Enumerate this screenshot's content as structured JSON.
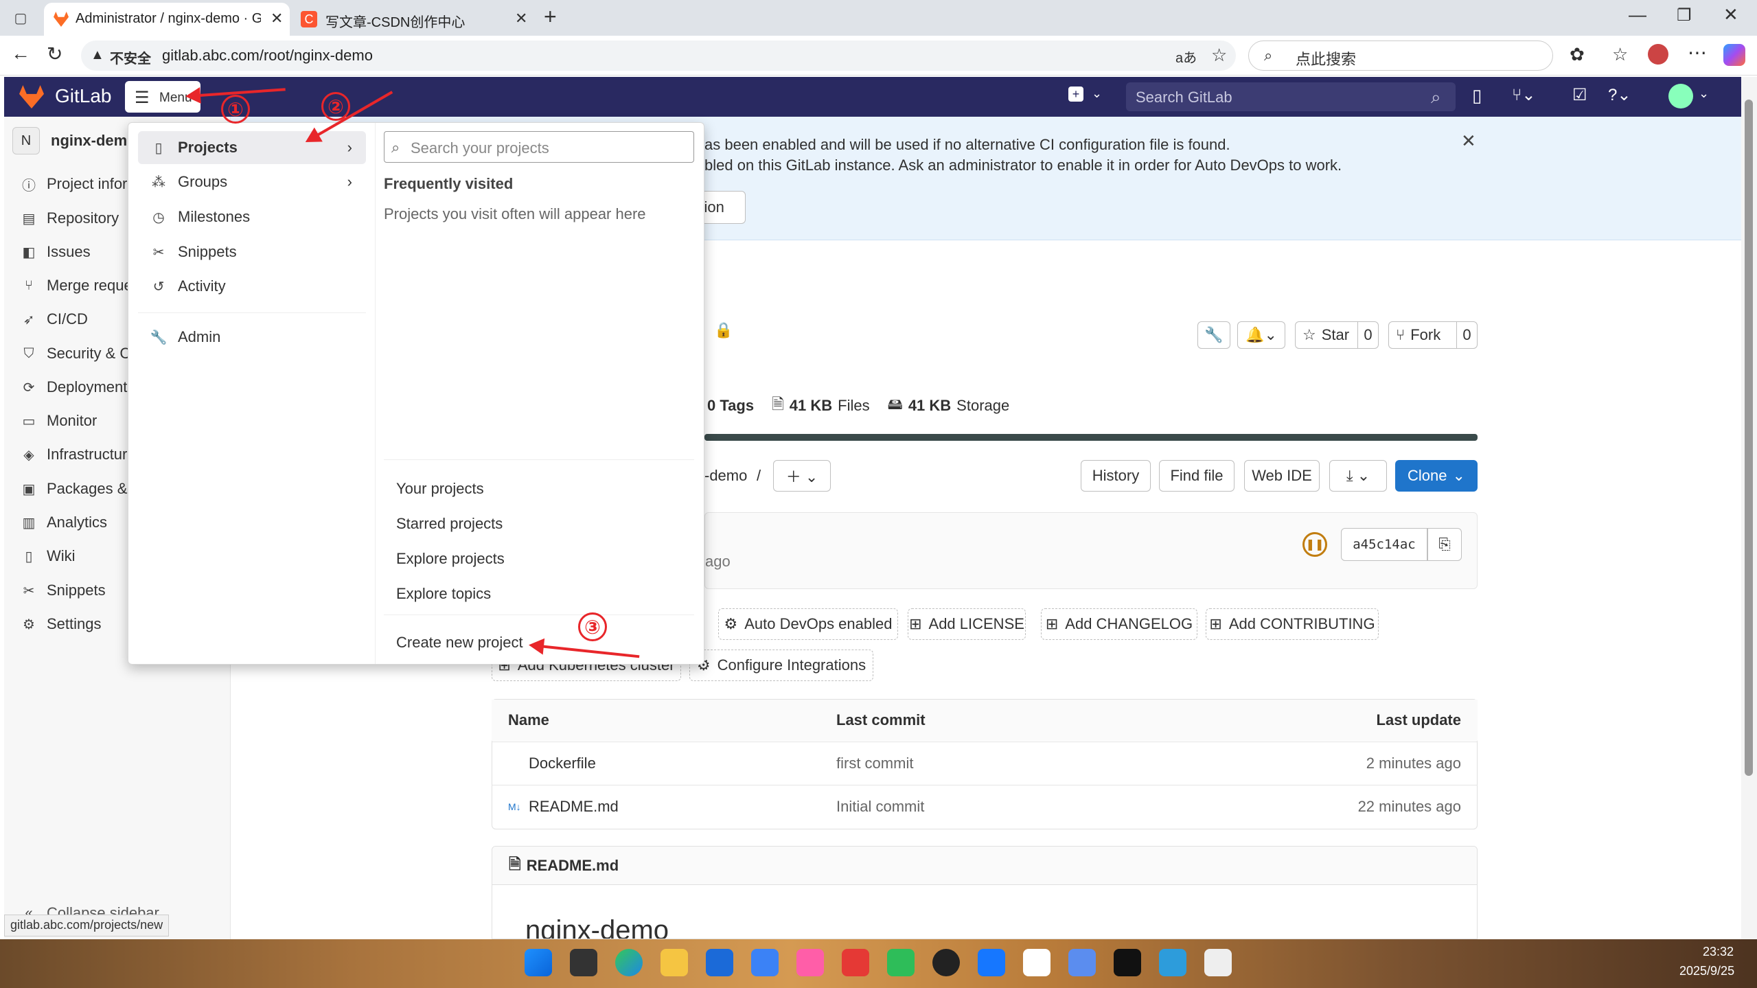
{
  "browser": {
    "tab1_title": "Administrator / nginx-demo · GitL",
    "tab2_title": "写文章-CSDN创作中心",
    "security_label": "不安全",
    "url": "gitlab.abc.com/root/nginx-demo",
    "search_placeholder": "点此搜索"
  },
  "gitlab_nav": {
    "brand": "GitLab",
    "menu_label": "Menu",
    "search_placeholder": "Search GitLab"
  },
  "sidebar": {
    "project_avatar": "N",
    "project_name": "nginx-demo",
    "items": [
      {
        "label": "Project information",
        "icon": "info-icon"
      },
      {
        "label": "Repository",
        "icon": "doc-icon"
      },
      {
        "label": "Issues",
        "icon": "issues-icon"
      },
      {
        "label": "Merge requests",
        "icon": "merge-icon"
      },
      {
        "label": "CI/CD",
        "icon": "rocket-icon"
      },
      {
        "label": "Security & Compliance",
        "icon": "shield-icon"
      },
      {
        "label": "Deployments",
        "icon": "deploy-icon"
      },
      {
        "label": "Monitor",
        "icon": "monitor-icon"
      },
      {
        "label": "Infrastructure",
        "icon": "infra-icon"
      },
      {
        "label": "Packages & Registries",
        "icon": "package-icon"
      },
      {
        "label": "Analytics",
        "icon": "chart-icon"
      },
      {
        "label": "Wiki",
        "icon": "book-icon"
      },
      {
        "label": "Snippets",
        "icon": "scissors-icon"
      },
      {
        "label": "Settings",
        "icon": "gear-icon"
      }
    ],
    "collapse_label": "Collapse sidebar"
  },
  "banner": {
    "line1": "as been enabled and will be used if no alternative CI configuration file is found.",
    "line2": "bled on this GitLab instance. Ask an administrator to enable it in order for Auto DevOps to work.",
    "button_label": "ation"
  },
  "project": {
    "star_label": "Star",
    "star_count": "0",
    "fork_label": "Fork",
    "fork_count": "0",
    "tags": "0 Tags",
    "files_size": "41 KB",
    "files_label": "Files",
    "storage_size": "41 KB",
    "storage_label": "Storage",
    "path_suffix": "-demo",
    "path_sep": "/",
    "history_label": "History",
    "find_file_label": "Find file",
    "web_ide_label": "Web IDE",
    "clone_label": "Clone",
    "commit_time": "ago",
    "commit_sha": "a45c14ac",
    "auto_devops_label": "Auto DevOps enabled",
    "add_license": "Add LICENSE",
    "add_changelog": "Add CHANGELOG",
    "add_contributing": "Add CONTRIBUTING",
    "add_k8s": "Add Kubernetes cluster",
    "configure_integrations": "Configure Integrations"
  },
  "files_table": {
    "headers": {
      "name": "Name",
      "last_commit": "Last commit",
      "last_update": "Last update"
    },
    "rows": [
      {
        "name": "Dockerfile",
        "commit": "first commit",
        "updated": "2 minutes ago"
      },
      {
        "name": "README.md",
        "commit": "Initial commit",
        "updated": "22 minutes ago"
      }
    ]
  },
  "readme": {
    "title": "README.md",
    "heading": "nginx-demo"
  },
  "menu": {
    "items": [
      {
        "label": "Projects",
        "has_sub": true
      },
      {
        "label": "Groups",
        "has_sub": true
      },
      {
        "label": "Milestones"
      },
      {
        "label": "Snippets"
      },
      {
        "label": "Activity"
      },
      {
        "label": "Admin"
      }
    ],
    "search_placeholder": "Search your projects",
    "frequently_visited": "Frequently visited",
    "empty_hint": "Projects you visit often will appear here",
    "links": [
      "Your projects",
      "Starred projects",
      "Explore projects",
      "Explore topics"
    ],
    "create_new": "Create new project"
  },
  "annotations": {
    "one": "①",
    "two": "②",
    "three": "③"
  },
  "status_url": "gitlab.abc.com/projects/new",
  "clock": {
    "time": "23:32",
    "date": "2025/9/25"
  },
  "colors": {
    "gitlab_nav": "#292961",
    "clone_blue": "#1f75cb",
    "annotation_red": "#e8262a",
    "banner": "#e9f3fc"
  }
}
